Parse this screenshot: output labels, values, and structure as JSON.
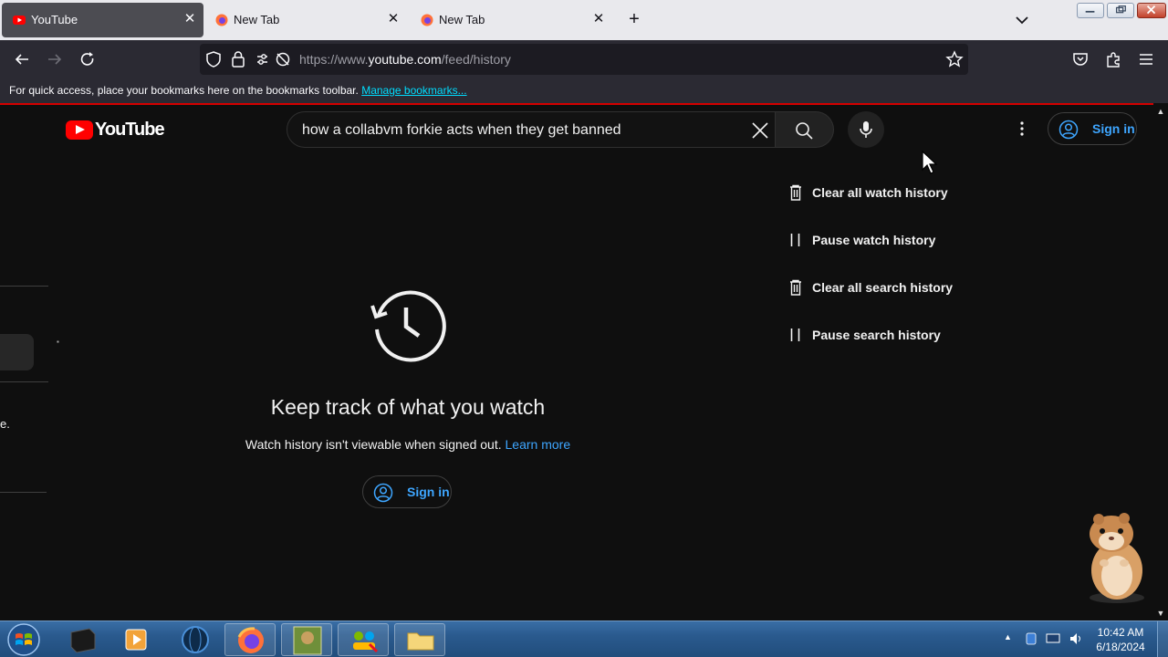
{
  "browser": {
    "tabs": [
      {
        "label": "YouTube",
        "active": true
      },
      {
        "label": "New Tab",
        "active": false
      },
      {
        "label": "New Tab",
        "active": false
      }
    ],
    "url_prefix": "https://www.",
    "url_host": "youtube.com",
    "url_path": "/feed/history",
    "bookmarks_message": "For quick access, place your bookmarks here on the bookmarks toolbar.",
    "bookmarks_link": "Manage bookmarks..."
  },
  "youtube": {
    "logo_text": "YouTube",
    "search_query": "how a collabvm forkie acts when they get banned",
    "signin_label": "Sign in",
    "empty_title": "Keep track of what you watch",
    "empty_subtitle": "Watch history isn't viewable when signed out.",
    "learn_more": "Learn more",
    "sidebar_fragment": "e.",
    "manage_actions": [
      {
        "label": "Clear all watch history",
        "icon": "trash-icon"
      },
      {
        "label": "Pause watch history",
        "icon": "pause-icon"
      },
      {
        "label": "Clear all search history",
        "icon": "trash-icon"
      },
      {
        "label": "Pause search history",
        "icon": "pause-icon"
      }
    ]
  },
  "taskbar": {
    "time": "10:42 AM",
    "date": "6/18/2024"
  },
  "colors": {
    "yt_red": "#ff0000",
    "link_blue": "#3ea6ff",
    "page_bg": "#0f0f0f",
    "firefox_chrome": "#2b2a33"
  }
}
